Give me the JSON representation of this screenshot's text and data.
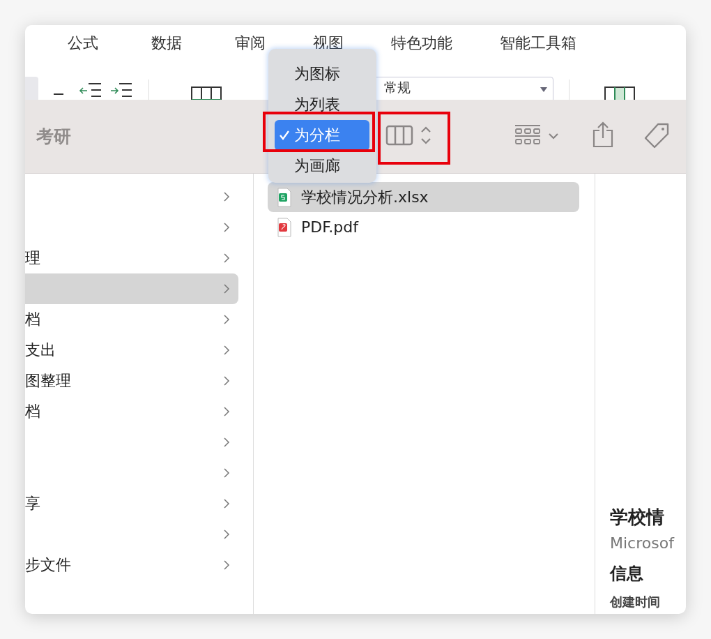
{
  "ribbon": {
    "tabs": [
      {
        "label": "公式"
      },
      {
        "label": "数据"
      },
      {
        "label": "审阅"
      },
      {
        "label": "视图"
      },
      {
        "label": "特色功能"
      },
      {
        "label": "智能工具箱"
      }
    ],
    "number_format": {
      "value": "常规"
    }
  },
  "finder": {
    "title": "考研",
    "view_menu": {
      "items": [
        {
          "label": "为图标",
          "selected": false
        },
        {
          "label": "为列表",
          "selected": false
        },
        {
          "label": "为分栏",
          "selected": true
        },
        {
          "label": "为画廊",
          "selected": false
        }
      ]
    }
  },
  "folder_column": {
    "rows": [
      {
        "selected": false
      },
      {
        "selected": false
      },
      {
        "text": "理",
        "selected": false
      },
      {
        "selected": true
      },
      {
        "text": "档",
        "selected": false
      },
      {
        "text": "支出",
        "selected": false
      },
      {
        "text": "图整理",
        "selected": false
      },
      {
        "text": "档",
        "selected": false
      },
      {
        "selected": false
      },
      {
        "selected": false
      },
      {
        "text": "享",
        "selected": false
      },
      {
        "selected": false
      },
      {
        "text": "步文件",
        "selected": false
      }
    ]
  },
  "files": [
    {
      "name": "学校情况分析.xlsx",
      "kind": "sheet",
      "selected": true
    },
    {
      "name": "PDF.pdf",
      "kind": "pdf",
      "selected": false
    }
  ],
  "preview": {
    "title": "学校情",
    "subtitle": "Microsof",
    "section": "信息",
    "field_label": "创建时间"
  }
}
